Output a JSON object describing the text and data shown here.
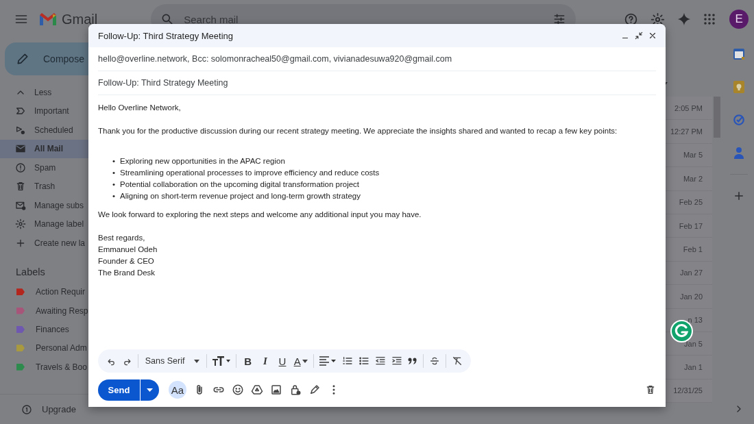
{
  "header": {
    "logo_text": "Gmail",
    "search": {
      "placeholder": "Search mail"
    },
    "avatar_letter": "E"
  },
  "sidebar": {
    "compose_label": "Compose",
    "items": [
      {
        "label": "Less",
        "selected": false
      },
      {
        "label": "Important",
        "selected": false
      },
      {
        "label": "Scheduled",
        "selected": false
      },
      {
        "label": "All Mail",
        "selected": true
      },
      {
        "label": "Spam",
        "selected": false
      },
      {
        "label": "Trash",
        "selected": false
      },
      {
        "label": "Manage subs",
        "selected": false
      },
      {
        "label": "Manage label",
        "selected": false
      },
      {
        "label": "Create new la",
        "selected": false
      }
    ],
    "labels_heading": "Labels",
    "labels": [
      {
        "name": "Action Requir",
        "color": "#b3261e"
      },
      {
        "name": "Awaiting Resp",
        "color": "#a8557a"
      },
      {
        "name": "Finances",
        "color": "#6e58b0"
      },
      {
        "name": "Personal Adm",
        "color": "#a9993f"
      },
      {
        "name": "Travels & Boo",
        "color": "#2e8b4e"
      }
    ],
    "upgrade_label": "Upgrade"
  },
  "mail_list": {
    "dates": [
      "2:05 PM",
      "12:27 PM",
      "Mar 5",
      "Mar 2",
      "Feb 25",
      "Feb 17",
      "Feb 1",
      "Jan 27",
      "Jan 20",
      "n 13",
      "Jan 5",
      "Jan 1",
      "12/31/25"
    ]
  },
  "compose_window": {
    "title": "Follow-Up: Third Strategy Meeting",
    "recipients": "hello@overline.network, Bcc: solomonracheal50@gmail.com, vivianadesuwa920@gmail.com",
    "subject": "Follow-Up: Third Strategy Meeting",
    "body": {
      "greeting": "Hello Overline Network,",
      "intro": "Thank you for the productive discussion during our recent strategy meeting. We appreciate the insights shared and wanted to recap a few key points:",
      "bullets": [
        {
          "marker": "•",
          "text": "Exploring new opportunities in the APAC region"
        },
        {
          "marker": "•",
          "text": "Streamlining operational processes to improve efficiency and reduce costs"
        },
        {
          "marker": "•",
          "text": "Potential collaboration on the upcoming digital transformation project"
        },
        {
          "marker": "•",
          "text": "Aligning on short-term revenue project and long-term growth strategy"
        }
      ],
      "closing": "We look forward to exploring the next steps and welcome any additional input you may have.",
      "signature": [
        "Best regards,",
        "Emmanuel Odeh",
        "Founder & CEO",
        "The Brand Desk"
      ]
    },
    "toolbar": {
      "font": "Sans Serif",
      "format_buttons": [
        {
          "kind": "bold",
          "glyph": "B"
        },
        {
          "kind": "italic",
          "glyph": "I"
        },
        {
          "kind": "underline",
          "glyph": "U"
        },
        {
          "kind": "color",
          "glyph": "A"
        }
      ]
    },
    "format_toggle": "Aa",
    "send_label": "Send"
  }
}
